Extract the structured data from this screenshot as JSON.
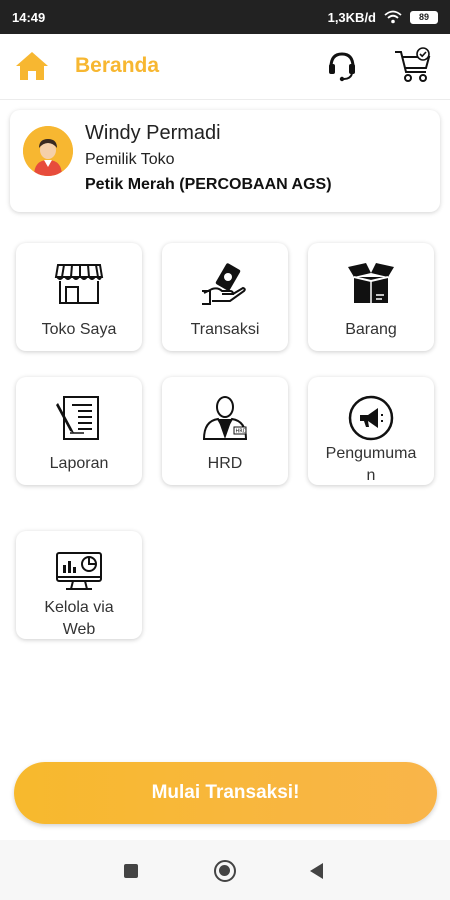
{
  "status_bar": {
    "time": "14:49",
    "network_speed": "1,3KB/d",
    "battery": "89"
  },
  "app_bar": {
    "title": "Beranda",
    "icons": [
      "home-icon",
      "headset-icon",
      "cart-icon"
    ]
  },
  "profile": {
    "name": "Windy Permadi",
    "role": "Pemilik Toko",
    "store": "Petik Merah (PERCOBAAN AGS)"
  },
  "menu": [
    {
      "label": "Toko Saya",
      "icon": "store-icon"
    },
    {
      "label": "Transaksi",
      "icon": "money-hand-icon"
    },
    {
      "label": "Barang",
      "icon": "box-icon"
    },
    {
      "label": "Laporan",
      "icon": "report-icon"
    },
    {
      "label": "HRD",
      "icon": "hrd-person-icon"
    },
    {
      "label": "Pengumuma\nn",
      "icon": "megaphone-icon"
    },
    {
      "label": "Kelola via\nWeb",
      "icon": "monitor-chart-icon"
    }
  ],
  "cta": {
    "label": "Mulai Transaksi!"
  },
  "colors": {
    "accent": "#F7B731",
    "text": "#222222"
  }
}
